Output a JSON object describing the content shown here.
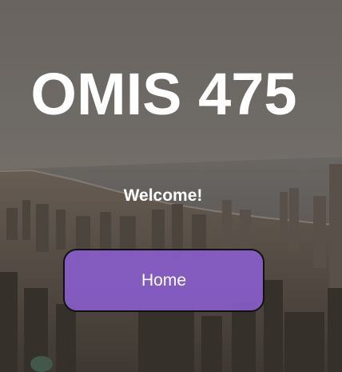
{
  "page": {
    "title": "OMIS 475",
    "welcome": "Welcome!"
  },
  "nav": {
    "home_label": "Home"
  },
  "colors": {
    "button_fill": "#8b5fd2",
    "button_border": "#111111",
    "text": "#ffffff"
  },
  "background": {
    "description_icon": "city-skyline-photo"
  }
}
